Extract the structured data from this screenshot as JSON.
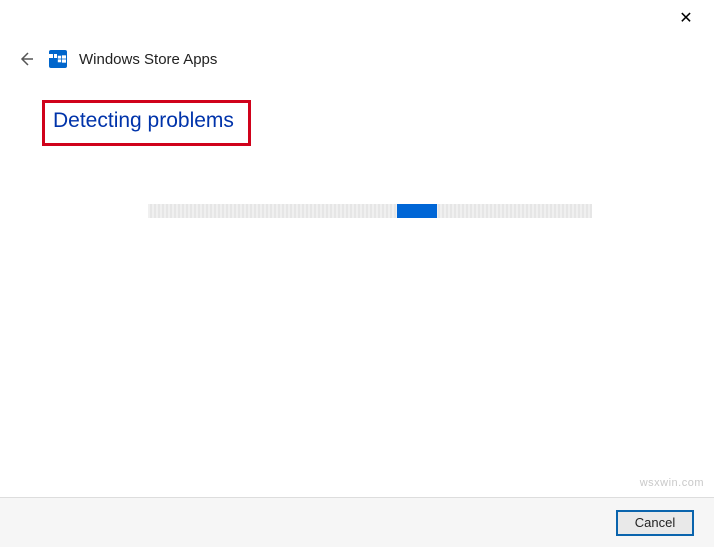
{
  "window": {
    "close_icon": "✕"
  },
  "header": {
    "back_icon": "←",
    "app_icon_name": "store-icon",
    "title": "Windows Store Apps"
  },
  "main": {
    "status": "Detecting problems"
  },
  "footer": {
    "cancel_label": "Cancel"
  },
  "watermark": "wsxwin.com"
}
